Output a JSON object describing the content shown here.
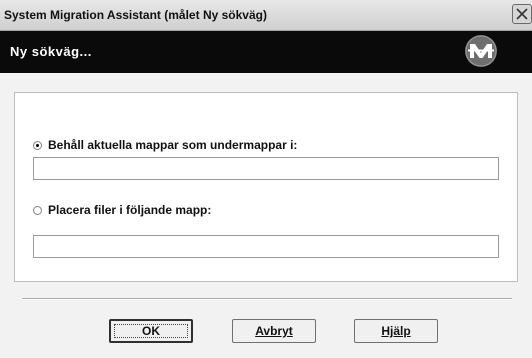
{
  "window": {
    "title": "System Migration Assistant (målet Ny sökväg)",
    "close_icon": "close-icon"
  },
  "header": {
    "title": "Ny sökväg...",
    "logo_icon": "sma-logo-icon"
  },
  "options": {
    "keep_folders": {
      "label": "Behåll aktuella mappar som undermappar i:",
      "selected": true,
      "value": ""
    },
    "place_files": {
      "label": "Placera filer i följande mapp:",
      "selected": false,
      "value": ""
    }
  },
  "buttons": {
    "ok_label": "OK",
    "cancel_label": "Avbryt",
    "help_label": "Hjälp"
  },
  "colors": {
    "header_bg": "#0a0a0a",
    "dialog_bg": "#f2f2f2"
  }
}
